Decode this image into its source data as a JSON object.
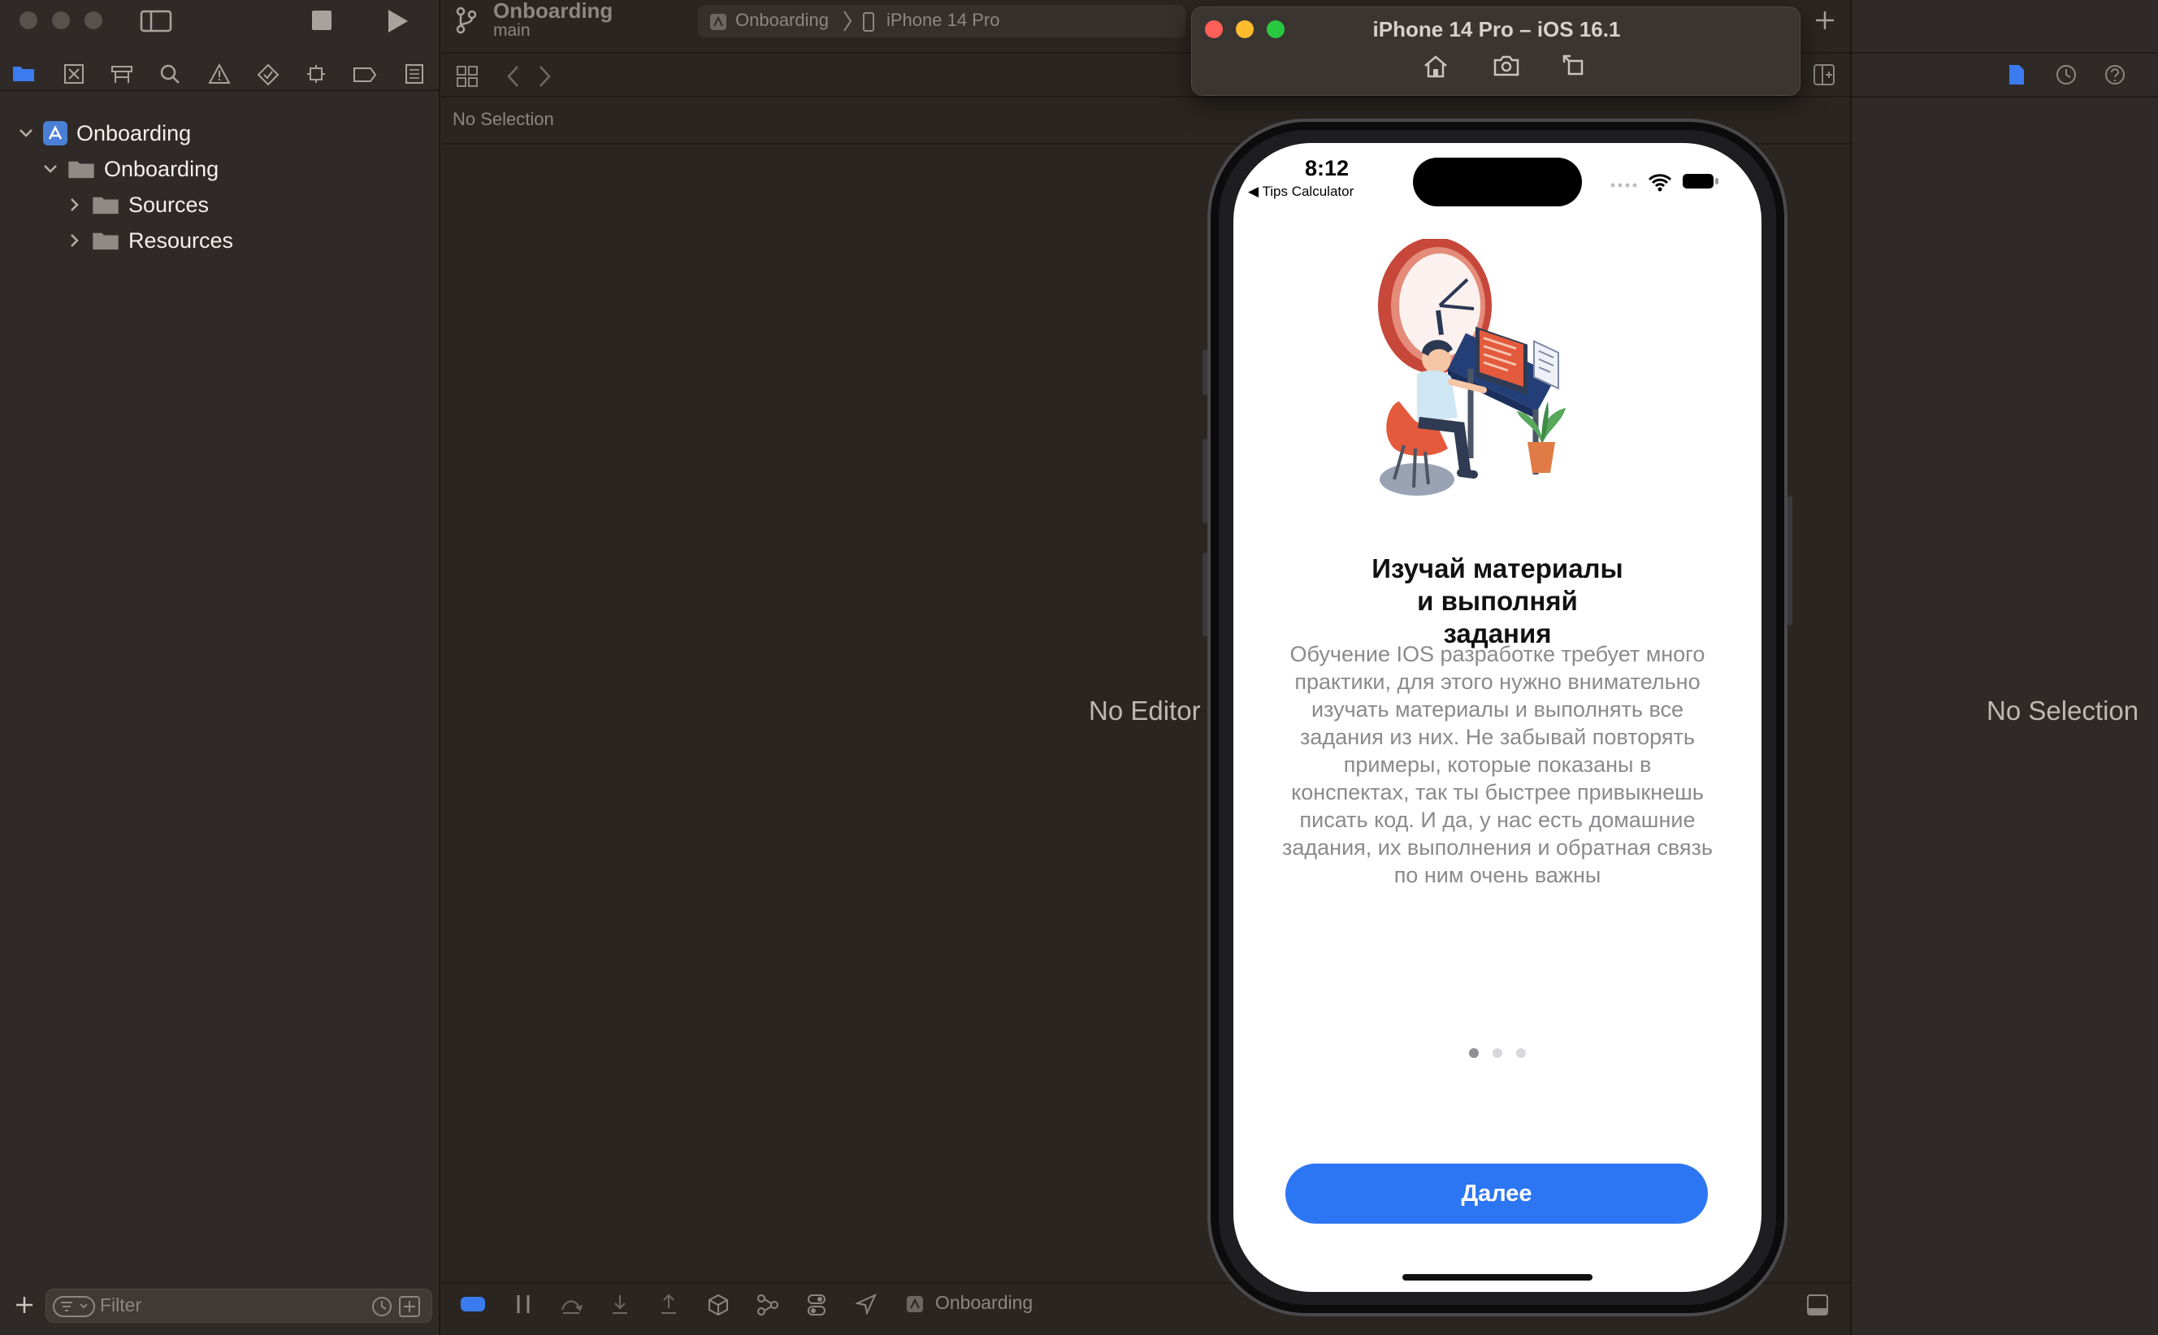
{
  "scheme": {
    "project": "Onboarding",
    "branch": "main",
    "target": "Onboarding",
    "device": "iPhone 14 Pro"
  },
  "navigator": {
    "items": [
      {
        "label": "Onboarding"
      },
      {
        "label": "Onboarding"
      },
      {
        "label": "Sources"
      },
      {
        "label": "Resources"
      }
    ],
    "filter_placeholder": "Filter"
  },
  "editor": {
    "jump_bar": "No Selection",
    "empty_message": "No Editor"
  },
  "inspector": {
    "empty_message": "No Selection"
  },
  "debug_bar": {
    "scheme_label": "Onboarding"
  },
  "simulator": {
    "window_title": "iPhone 14 Pro – iOS 16.1",
    "status": {
      "time": "8:12",
      "back_app": "◀ Tips Calculator"
    },
    "page": {
      "title": "Изучай материалы и выполняй задания",
      "body": "Обучение IOS разработке требует много практики, для этого нужно внимательно изучать материалы и выполнять все задания из них. Не забывай повторять примеры, которые показаны в конспектах, так ты быстрее привыкнешь писать код. И да, у нас есть домашние задания, их выполнения и обратная связь по ним очень важны",
      "page_count": 3,
      "current_page": 1,
      "next_button": "Далее"
    }
  },
  "colors": {
    "accent": "#2d76f3",
    "window_bg": "#2a2521",
    "panel_bg": "#2f2a27"
  }
}
